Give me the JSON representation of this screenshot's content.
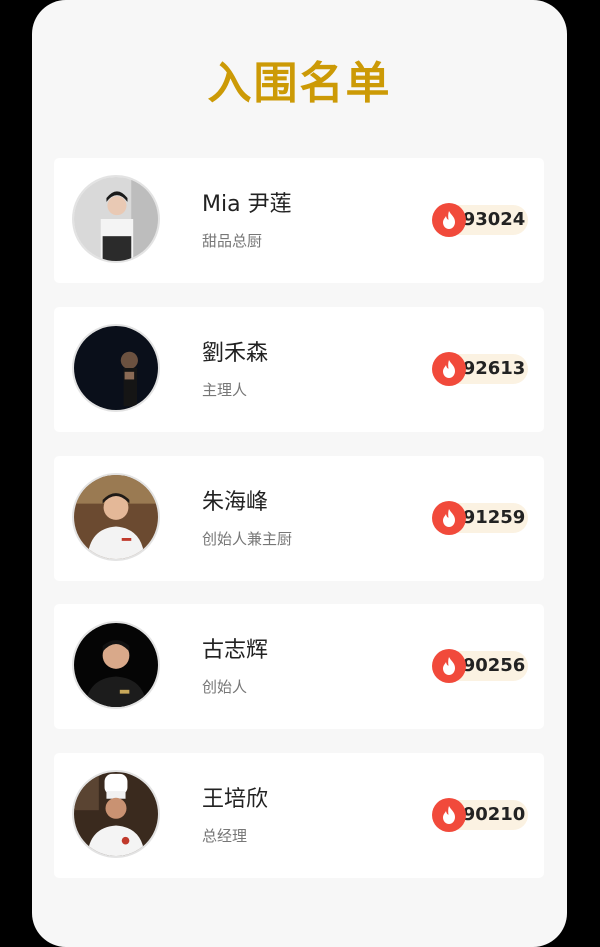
{
  "page": {
    "title": "入围名单"
  },
  "colors": {
    "title": "#cc9a06",
    "fire_badge": "#f14a3b",
    "score_bg": "#fbf2e2"
  },
  "candidates": [
    {
      "name": "Mia 尹莲",
      "role": "甜品总厨",
      "score": "93024",
      "avatar_icon": "chef-avatar"
    },
    {
      "name": "劉禾森",
      "role": "主理人",
      "score": "92613",
      "avatar_icon": "dark-portrait-avatar"
    },
    {
      "name": "朱海峰",
      "role": "创始人兼主厨",
      "score": "91259",
      "avatar_icon": "chef-avatar"
    },
    {
      "name": "古志辉",
      "role": "创始人",
      "score": "90256",
      "avatar_icon": "chef-avatar"
    },
    {
      "name": "王培欣",
      "role": "总经理",
      "score": "90210",
      "avatar_icon": "chef-hat-avatar"
    }
  ],
  "icons": {
    "score_icon": "fire-icon"
  }
}
